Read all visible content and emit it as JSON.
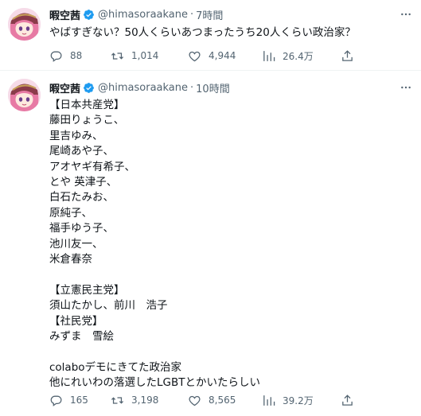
{
  "tweets": [
    {
      "display_name": "暇空茜",
      "handle": "@himasoraakane",
      "separator": "·",
      "time": "7時間",
      "text": "やばすぎない？50人くらいあつまったうち20人くらい政治家？",
      "replies": "88",
      "retweets": "1,014",
      "likes": "4,944",
      "views": "26.4万"
    },
    {
      "display_name": "暇空茜",
      "handle": "@himasoraakane",
      "separator": "·",
      "time": "10時間",
      "text": "【日本共産党】\n藤田りょうこ、\n里吉ゆみ、\n尾崎あや子、\nアオヤギ有希子、\nとや 英津子、\n白石たみお、\n原純子、\n福手ゆう子、\n池川友一、\n米倉春奈\n\n【立憲民主党】\n須山たかし、前川　浩子\n【社民党】\nみずま　雪絵\n\ncolaboデモにきてた政治家\n他にれいわの落選したLGBTとかいたらしい",
      "replies": "165",
      "retweets": "3,198",
      "likes": "8,565",
      "views": "39.2万"
    }
  ],
  "icons": {
    "avatar": "anime-avatar",
    "verified": "verified-badge-icon",
    "more": "more-icon",
    "reply": "reply-icon",
    "retweet": "retweet-icon",
    "like": "like-icon",
    "views": "views-icon",
    "share": "share-icon"
  },
  "colors": {
    "text": "#0f1419",
    "secondary": "#536471",
    "verified": "#1d9bf0",
    "divider": "#eff3f4"
  }
}
